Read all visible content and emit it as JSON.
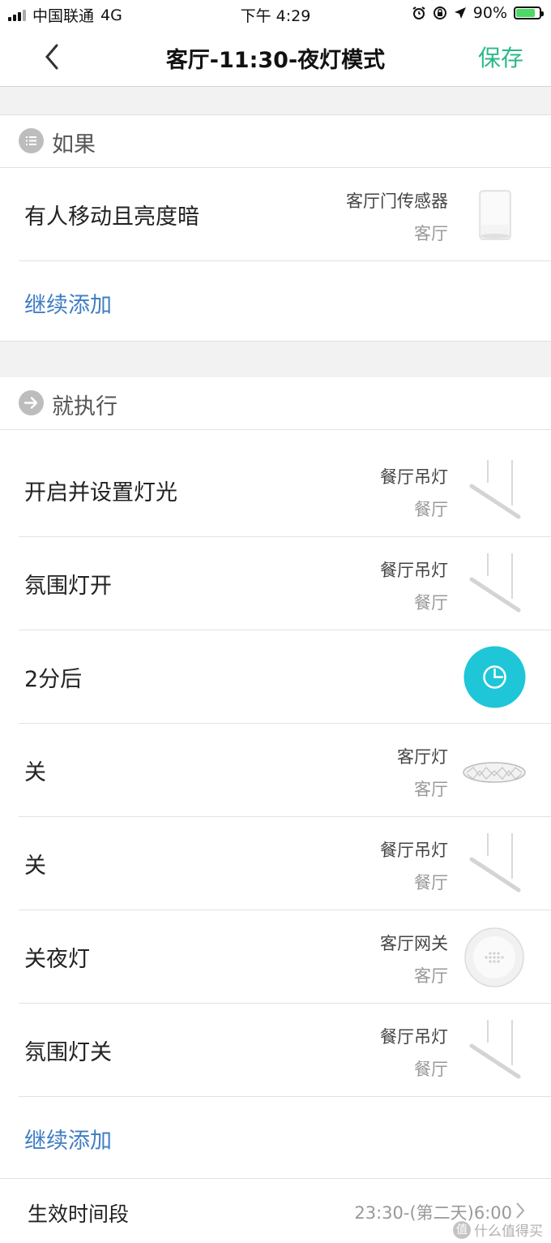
{
  "status_bar": {
    "carrier": "中国联通",
    "network": "4G",
    "time": "下午 4:29",
    "battery_percent": "90%",
    "battery_level": 0.9
  },
  "nav": {
    "title": "客厅-11:30-夜灯模式",
    "save_label": "保存",
    "back_icon": "chevron-left-icon"
  },
  "if_section": {
    "header": "如果",
    "icon": "list-icon",
    "conditions": [
      {
        "label": "有人移动且亮度暗",
        "device": "客厅门传感器",
        "room": "客厅",
        "thumb": "motion-sensor"
      }
    ],
    "add_label": "继续添加"
  },
  "then_section": {
    "header": "就执行",
    "icon": "arrow-right-icon",
    "actions": [
      {
        "label": "开启并设置灯光",
        "device": "餐厅吊灯",
        "room": "餐厅",
        "thumb": "pendant-light"
      },
      {
        "label": "氛围灯开",
        "device": "餐厅吊灯",
        "room": "餐厅",
        "thumb": "pendant-light"
      },
      {
        "label": "2分后",
        "device": "",
        "room": "",
        "thumb": "timer"
      },
      {
        "label": "关",
        "device": "客厅灯",
        "room": "客厅",
        "thumb": "ceiling-light"
      },
      {
        "label": "关",
        "device": "餐厅吊灯",
        "room": "餐厅",
        "thumb": "pendant-light"
      },
      {
        "label": "关夜灯",
        "device": "客厅网关",
        "room": "客厅",
        "thumb": "gateway"
      },
      {
        "label": "氛围灯关",
        "device": "餐厅吊灯",
        "room": "餐厅",
        "thumb": "pendant-light"
      }
    ],
    "add_label": "继续添加"
  },
  "effective_time": {
    "label": "生效时间段",
    "value": "23:30-(第二天)6:00"
  },
  "watermark": {
    "logo_text": "值",
    "text": "什么值得买"
  },
  "colors": {
    "save": "#2bb88a",
    "link": "#3f7ec4",
    "timer": "#1ec6d8",
    "band": "#f2f2f2"
  }
}
